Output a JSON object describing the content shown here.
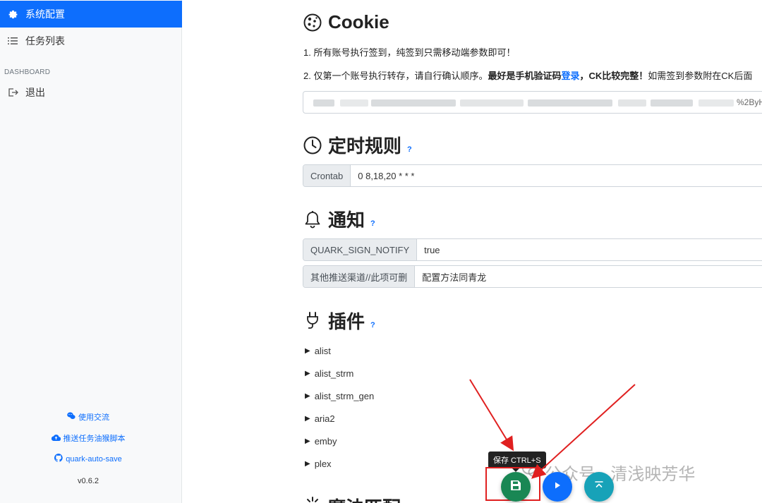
{
  "sidebar": {
    "nav": [
      {
        "label": "系统配置",
        "icon": "gear-icon",
        "active": true
      },
      {
        "label": "任务列表",
        "icon": "list-icon",
        "active": false
      }
    ],
    "section_heading": "DASHBOARD",
    "logout_label": "退出",
    "links": [
      {
        "label": "使用交流",
        "icon": "wechat-icon"
      },
      {
        "label": "推送任务油猴脚本",
        "icon": "cloud-icon"
      },
      {
        "label": "quark-auto-save",
        "icon": "github-icon"
      }
    ],
    "version": "v0.6.2"
  },
  "cookie": {
    "title": "Cookie",
    "note1": "1. 所有账号执行签到，纯签到只需移动端参数即可！",
    "note2_prefix": "2. 仅第一个账号执行转存，请自行确认顺序。",
    "note2_bold": "最好是手机验证码",
    "note2_link": "登录",
    "note2_bold2": "，CK比较完整！",
    "note2_suffix": "如需签到参数附在CK后面",
    "value_tail": "%2ByH"
  },
  "schedule": {
    "title": "定时规则",
    "help": "?",
    "addon": "Crontab",
    "value": "0 8,18,20 * * *"
  },
  "notify": {
    "title": "通知",
    "help": "?",
    "rows": [
      {
        "key": "QUARK_SIGN_NOTIFY",
        "value": "true"
      },
      {
        "key": "其他推送渠道//此项可删",
        "value": "配置方法同青龙"
      }
    ]
  },
  "plugins": {
    "title": "插件",
    "help": "?",
    "items": [
      "alist",
      "alist_strm",
      "alist_strm_gen",
      "aria2",
      "emby",
      "plex"
    ]
  },
  "next_section": {
    "title": "魔法匹配"
  },
  "actions": {
    "save_tooltip": "保存 CTRL+S"
  },
  "watermark": "公众号 · 清浅映芳华",
  "colors": {
    "primary": "#0d6efd",
    "success": "#198754",
    "info": "#17a2b8",
    "annotation_red": "#e02020"
  }
}
